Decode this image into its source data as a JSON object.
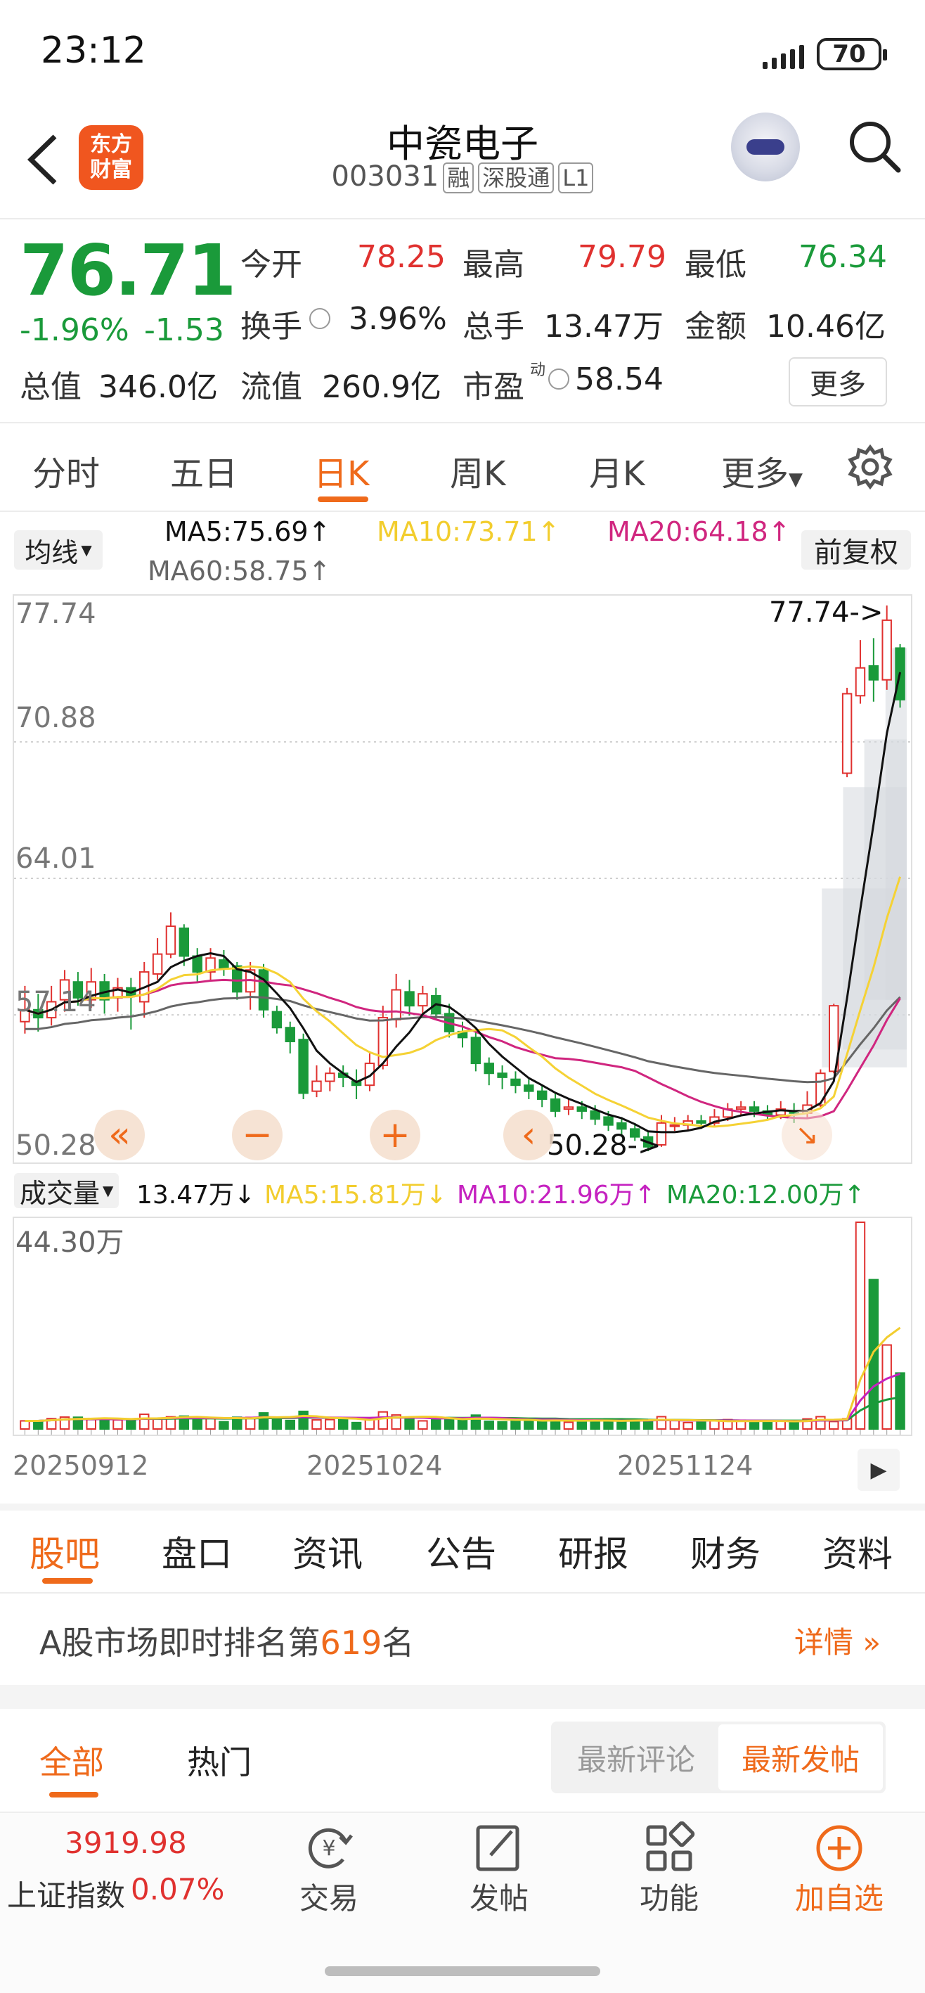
{
  "status": {
    "time": "23:12",
    "battery": "70"
  },
  "header": {
    "app_logo_line1": "东方",
    "app_logo_line2": "财富",
    "stock_name": "中瓷电子",
    "stock_code": "003031",
    "tags": [
      "融",
      "深股通",
      "L1"
    ]
  },
  "quote": {
    "price": "76.71",
    "change_pct": "-1.96%",
    "change_abs": "-1.53",
    "open_label": "今开",
    "open": "78.25",
    "high_label": "最高",
    "high": "79.79",
    "low_label": "最低",
    "low": "76.34",
    "turnover_label": "换手",
    "turnover": "3.96%",
    "volume_label": "总手",
    "volume": "13.47万",
    "amount_label": "金额",
    "amount": "10.46亿",
    "mktcap_label": "总值",
    "mktcap": "346.0亿",
    "float_label": "流值",
    "float_cap": "260.9亿",
    "pe_label": "市盈",
    "pe_sup": "动",
    "pe": "58.54",
    "more_label": "更多"
  },
  "period_tabs": [
    "分时",
    "五日",
    "日K",
    "周K",
    "月K",
    "更多"
  ],
  "ma_legend": {
    "select_label": "均线",
    "ma5": "MA5:75.69↑",
    "ma10": "MA10:73.71↑",
    "ma20": "MA20:64.18↑",
    "ma60": "MA60:58.75↑",
    "restore_label": "前复权"
  },
  "price_axis": [
    "77.74",
    "70.88",
    "64.01",
    "57.14",
    "50.28"
  ],
  "annotations": {
    "high": "77.74->",
    "low": "50.28->"
  },
  "volume_legend": {
    "select_label": "成交量",
    "vol": "13.47万↓",
    "ma5": "MA5:15.81万↓",
    "ma10": "MA10:21.96万↑",
    "ma20": "MA20:12.00万↑",
    "axis_max": "44.30万"
  },
  "date_axis": [
    "20250912",
    "20251024",
    "20251124"
  ],
  "colors": {
    "up": "#e0312f",
    "down": "#1a9a3a",
    "ma5": "#111111",
    "ma10": "#f5d235",
    "ma20": "#d0267f",
    "ma60": "#666666",
    "accent": "#ef6a1b"
  },
  "chart_data": {
    "type": "candlestick",
    "ylim": [
      50.28,
      77.74
    ],
    "x_tick_labels": [
      "20250912",
      "20251024",
      "20251124"
    ],
    "candles": [
      {
        "o": 56.8,
        "c": 57.4,
        "h": 58.6,
        "l": 56.2
      },
      {
        "o": 57.4,
        "c": 57.0,
        "h": 58.2,
        "l": 56.3
      },
      {
        "o": 57.0,
        "c": 57.8,
        "h": 58.6,
        "l": 56.6
      },
      {
        "o": 57.9,
        "c": 58.9,
        "h": 59.4,
        "l": 57.3
      },
      {
        "o": 58.8,
        "c": 58.0,
        "h": 59.3,
        "l": 57.6
      },
      {
        "o": 57.9,
        "c": 58.8,
        "h": 59.5,
        "l": 57.5
      },
      {
        "o": 58.8,
        "c": 57.9,
        "h": 59.2,
        "l": 57.2
      },
      {
        "o": 58.0,
        "c": 58.5,
        "h": 59.0,
        "l": 57.3
      },
      {
        "o": 58.5,
        "c": 58.1,
        "h": 59.0,
        "l": 56.4
      },
      {
        "o": 57.8,
        "c": 59.3,
        "h": 59.8,
        "l": 57.0
      },
      {
        "o": 59.2,
        "c": 60.2,
        "h": 61.0,
        "l": 58.9
      },
      {
        "o": 60.2,
        "c": 61.6,
        "h": 62.3,
        "l": 60.0
      },
      {
        "o": 61.5,
        "c": 60.1,
        "h": 61.7,
        "l": 59.6
      },
      {
        "o": 60.1,
        "c": 59.3,
        "h": 60.5,
        "l": 58.8
      },
      {
        "o": 59.3,
        "c": 60.0,
        "h": 60.5,
        "l": 58.9
      },
      {
        "o": 59.9,
        "c": 59.5,
        "h": 60.4,
        "l": 59.1
      },
      {
        "o": 59.6,
        "c": 58.3,
        "h": 59.8,
        "l": 57.9
      },
      {
        "o": 58.3,
        "c": 59.4,
        "h": 59.8,
        "l": 57.4
      },
      {
        "o": 59.4,
        "c": 57.4,
        "h": 59.7,
        "l": 57.0
      },
      {
        "o": 57.3,
        "c": 56.5,
        "h": 57.6,
        "l": 56.2
      },
      {
        "o": 56.5,
        "c": 55.8,
        "h": 56.8,
        "l": 55.2
      },
      {
        "o": 55.9,
        "c": 53.2,
        "h": 56.2,
        "l": 52.9
      },
      {
        "o": 53.3,
        "c": 53.8,
        "h": 54.6,
        "l": 53.0
      },
      {
        "o": 53.8,
        "c": 54.2,
        "h": 54.5,
        "l": 53.3
      },
      {
        "o": 54.2,
        "c": 54.0,
        "h": 54.6,
        "l": 53.5
      },
      {
        "o": 53.8,
        "c": 53.6,
        "h": 54.4,
        "l": 52.9
      },
      {
        "o": 53.6,
        "c": 54.7,
        "h": 55.2,
        "l": 53.3
      },
      {
        "o": 54.6,
        "c": 57.0,
        "h": 57.6,
        "l": 54.4
      },
      {
        "o": 56.9,
        "c": 58.4,
        "h": 59.2,
        "l": 56.5
      },
      {
        "o": 58.3,
        "c": 57.6,
        "h": 58.9,
        "l": 57.1
      },
      {
        "o": 57.6,
        "c": 58.2,
        "h": 58.6,
        "l": 57.2
      },
      {
        "o": 58.1,
        "c": 57.2,
        "h": 58.5,
        "l": 56.9
      },
      {
        "o": 57.2,
        "c": 56.3,
        "h": 57.7,
        "l": 56.0
      },
      {
        "o": 56.3,
        "c": 56.0,
        "h": 56.8,
        "l": 55.5
      },
      {
        "o": 56.0,
        "c": 54.7,
        "h": 56.4,
        "l": 54.3
      },
      {
        "o": 54.7,
        "c": 54.2,
        "h": 55.0,
        "l": 53.6
      },
      {
        "o": 54.2,
        "c": 54.0,
        "h": 54.6,
        "l": 53.4
      },
      {
        "o": 53.9,
        "c": 53.6,
        "h": 54.3,
        "l": 53.2
      },
      {
        "o": 53.6,
        "c": 53.3,
        "h": 53.9,
        "l": 52.9
      },
      {
        "o": 53.3,
        "c": 52.9,
        "h": 53.6,
        "l": 52.5
      },
      {
        "o": 52.9,
        "c": 52.3,
        "h": 53.2,
        "l": 52.0
      },
      {
        "o": 52.4,
        "c": 52.5,
        "h": 52.9,
        "l": 52.1
      },
      {
        "o": 52.5,
        "c": 52.3,
        "h": 52.8,
        "l": 51.9
      },
      {
        "o": 52.3,
        "c": 51.9,
        "h": 52.6,
        "l": 51.6
      },
      {
        "o": 52.0,
        "c": 51.6,
        "h": 52.3,
        "l": 51.3
      },
      {
        "o": 51.7,
        "c": 51.4,
        "h": 52.0,
        "l": 51.1
      },
      {
        "o": 51.4,
        "c": 51.0,
        "h": 51.7,
        "l": 50.8
      },
      {
        "o": 51.0,
        "c": 50.5,
        "h": 51.3,
        "l": 50.28
      },
      {
        "o": 50.6,
        "c": 51.7,
        "h": 52.1,
        "l": 50.5
      },
      {
        "o": 51.6,
        "c": 51.6,
        "h": 52.0,
        "l": 51.3
      },
      {
        "o": 51.6,
        "c": 51.8,
        "h": 52.1,
        "l": 51.3
      },
      {
        "o": 51.8,
        "c": 51.7,
        "h": 52.1,
        "l": 51.4
      },
      {
        "o": 51.7,
        "c": 52.0,
        "h": 52.4,
        "l": 51.5
      },
      {
        "o": 52.0,
        "c": 52.4,
        "h": 52.7,
        "l": 51.8
      },
      {
        "o": 52.4,
        "c": 52.5,
        "h": 52.8,
        "l": 52.1
      },
      {
        "o": 52.5,
        "c": 52.3,
        "h": 52.8,
        "l": 52.0
      },
      {
        "o": 52.3,
        "c": 52.1,
        "h": 52.6,
        "l": 51.9
      },
      {
        "o": 52.1,
        "c": 52.4,
        "h": 52.8,
        "l": 51.9
      },
      {
        "o": 52.3,
        "c": 52.2,
        "h": 52.7,
        "l": 51.7
      },
      {
        "o": 52.2,
        "c": 52.6,
        "h": 53.3,
        "l": 51.9
      },
      {
        "o": 52.6,
        "c": 54.2,
        "h": 54.4,
        "l": 52.5
      },
      {
        "o": 54.3,
        "c": 57.6,
        "h": 57.7,
        "l": 54.2
      },
      {
        "o": 69.3,
        "c": 73.3,
        "h": 73.6,
        "l": 69.1
      },
      {
        "o": 73.2,
        "c": 74.6,
        "h": 76.0,
        "l": 72.8
      },
      {
        "o": 74.7,
        "c": 74.0,
        "h": 76.1,
        "l": 72.9
      },
      {
        "o": 74.0,
        "c": 77.0,
        "h": 77.74,
        "l": 73.5
      },
      {
        "o": 75.6,
        "c": 73.0,
        "h": 75.8,
        "l": 72.6
      }
    ],
    "volume_max": "44.30万"
  },
  "bottom_tabs": [
    "股吧",
    "盘口",
    "资讯",
    "公告",
    "研报",
    "财务",
    "资料"
  ],
  "rank": {
    "prefix": "A股市场即时排名第",
    "number": "619",
    "suffix": "名",
    "detail": "详情"
  },
  "sub_tabs": {
    "all": "全部",
    "hot": "热门",
    "latest_comment": "最新评论",
    "latest_post": "最新发帖"
  },
  "bottom_nav": {
    "index_value": "3919.98",
    "index_name": "上证指数",
    "index_change": "0.07%",
    "trade": "交易",
    "post": "发帖",
    "features": "功能",
    "add_watch": "加自选"
  }
}
